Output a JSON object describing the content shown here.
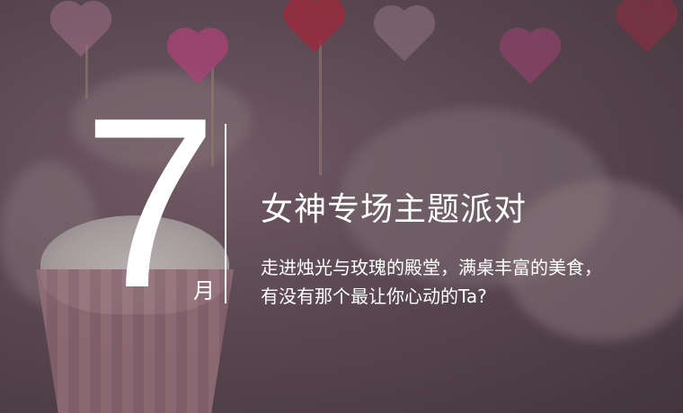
{
  "banner": {
    "number": "7",
    "month": "月",
    "title": "女神专场主题派对",
    "description_lines": [
      "走进烛光与玫瑰的殿堂，满桌丰富的美食，",
      "有没有那个最让你心动的Ta?"
    ]
  },
  "colors": {
    "text": "#ffffff",
    "heart_pink": "#e0559a",
    "heart_red": "#d6273f"
  }
}
